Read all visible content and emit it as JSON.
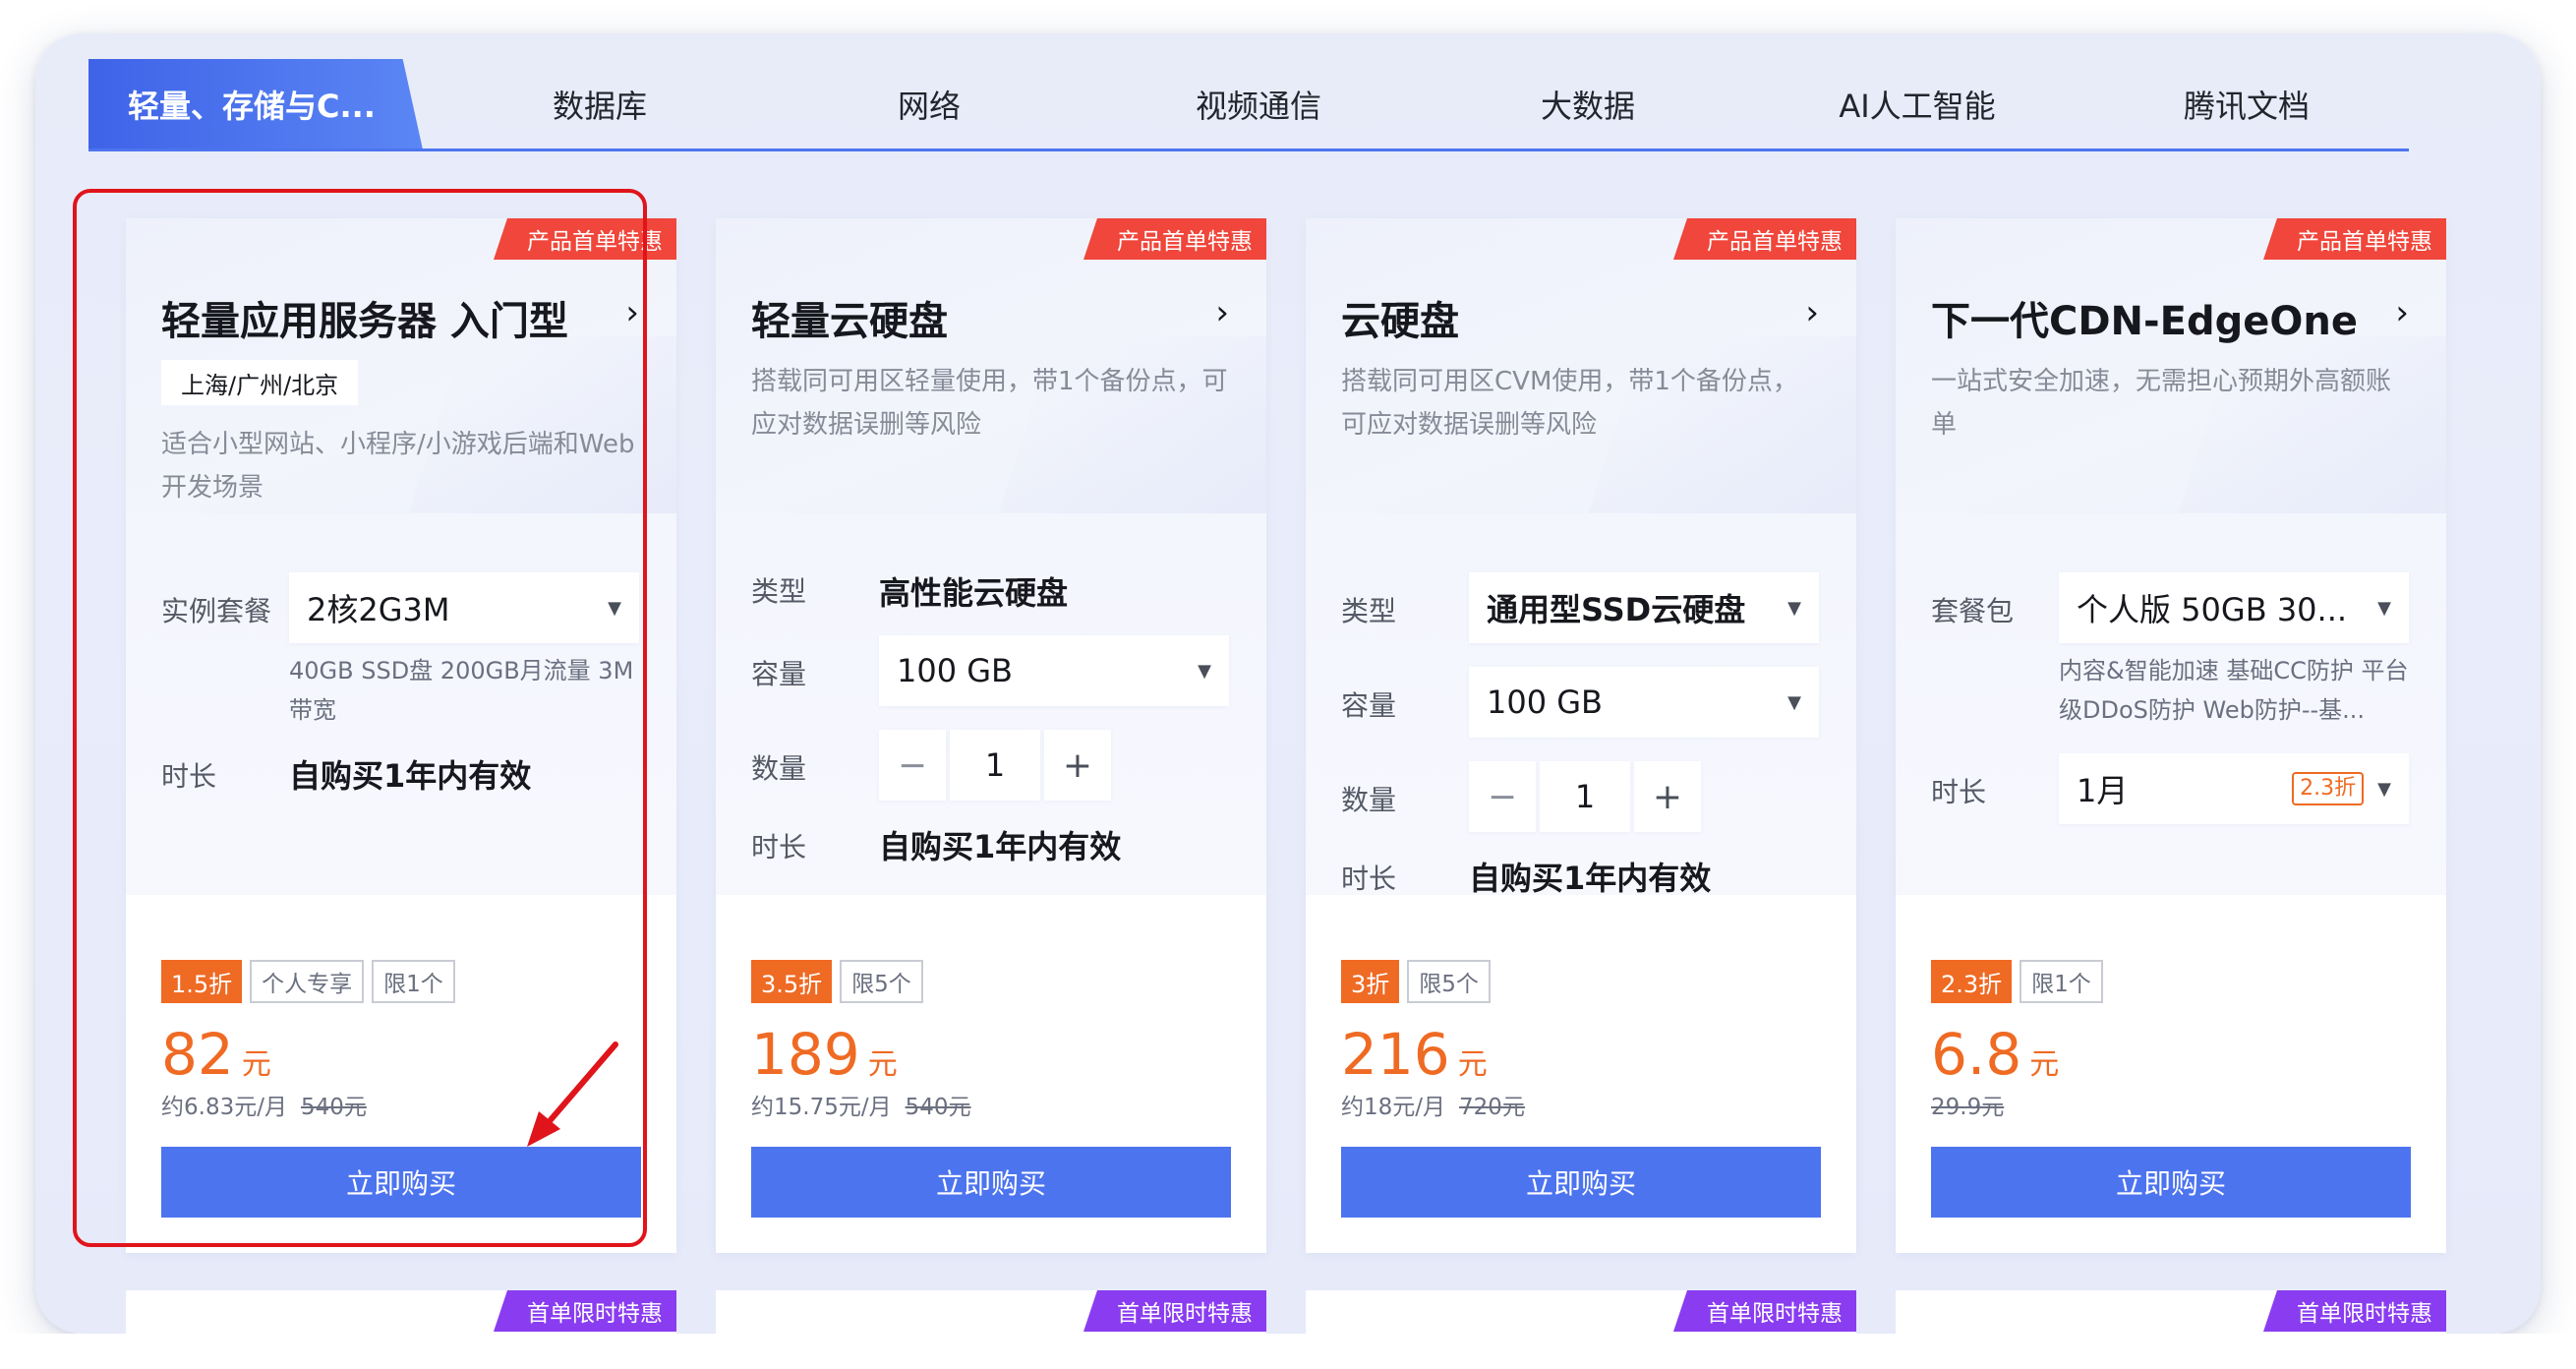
{
  "tabs": [
    {
      "label": "轻量、存储与C..."
    },
    {
      "label": "数据库"
    },
    {
      "label": "网络"
    },
    {
      "label": "视频通信"
    },
    {
      "label": "大数据"
    },
    {
      "label": "AI人工智能"
    },
    {
      "label": "腾讯文档"
    }
  ],
  "cards": [
    {
      "ribbon": "产品首单特惠",
      "title": "轻量应用服务器 入门型",
      "region": "上海/广州/北京",
      "desc": "适合小型网站、小程序/小游戏后端和Web开发场景",
      "package_label": "实例套餐",
      "package_value": "2核2G3M",
      "package_hint": "40GB SSD盘 200GB月流量 3M带宽",
      "duration_label": "时长",
      "duration_value": "自购买1年内有效",
      "discount": "1.5折",
      "tags": [
        "个人专享",
        "限1个"
      ],
      "price": "82",
      "price_unit": "元",
      "monthly": "约6.83元/月",
      "original": "540元",
      "buy_label": "立即购买"
    },
    {
      "ribbon": "产品首单特惠",
      "title": "轻量云硬盘",
      "desc": "搭载同可用区轻量使用，带1个备份点，可应对数据误删等风险",
      "type_label": "类型",
      "type_value": "高性能云硬盘",
      "capacity_label": "容量",
      "capacity_value": "100 GB",
      "qty_label": "数量",
      "qty_value": "1",
      "duration_label": "时长",
      "duration_value": "自购买1年内有效",
      "discount": "3.5折",
      "tags": [
        "限5个"
      ],
      "price": "189",
      "price_unit": "元",
      "monthly": "约15.75元/月",
      "original": "540元",
      "buy_label": "立即购买"
    },
    {
      "ribbon": "产品首单特惠",
      "title": "云硬盘",
      "desc": "搭载同可用区CVM使用，带1个备份点，可应对数据误删等风险",
      "type_label": "类型",
      "type_value": "通用型SSD云硬盘",
      "capacity_label": "容量",
      "capacity_value": "100 GB",
      "qty_label": "数量",
      "qty_value": "1",
      "duration_label": "时长",
      "duration_value": "自购买1年内有效",
      "discount": "3折",
      "tags": [
        "限5个"
      ],
      "price": "216",
      "price_unit": "元",
      "monthly": "约18元/月",
      "original": "720元",
      "buy_label": "立即购买"
    },
    {
      "ribbon": "产品首单特惠",
      "title": "下一代CDN-EdgeOne",
      "desc": "一站式安全加速，无需担心预期外高额账单",
      "package_label": "套餐包",
      "package_value": "个人版 50GB 30...",
      "package_hint": "内容&智能加速 基础CC防护 平台级DDoS防护 Web防护--基...",
      "duration_label": "时长",
      "duration_value": "1月",
      "duration_discount": "2.3折",
      "discount": "2.3折",
      "tags": [
        "限1个"
      ],
      "price": "6.8",
      "price_unit": "元",
      "original": "29.9元",
      "buy_label": "立即购买"
    }
  ],
  "bottom_ribbons": [
    "首单限时特惠",
    "首单限时特惠",
    "首单限时特惠",
    "首单限时特惠"
  ],
  "colors": {
    "accent": "#4d74ef",
    "price": "#ef6a23",
    "ribbon_red": "#f0463b",
    "ribbon_purple": "#8a3df0",
    "highlight": "#e0141b"
  }
}
